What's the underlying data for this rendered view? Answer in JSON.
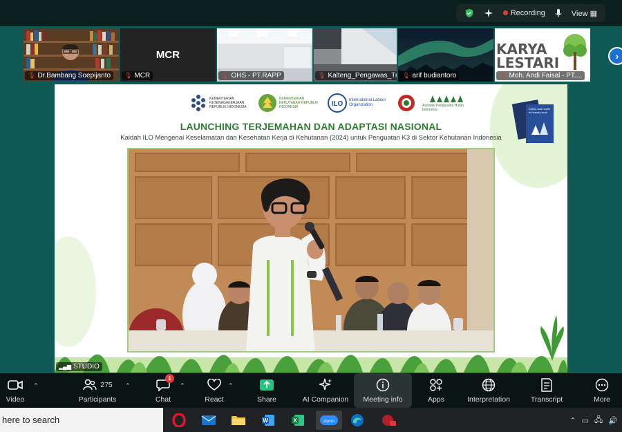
{
  "topbar": {
    "recording_label": "Recording",
    "view_label": "View"
  },
  "gallery": {
    "tiles": [
      {
        "label": "Dr.Bambang Soepijanto",
        "muted": true
      },
      {
        "label": "MCR",
        "muted": true,
        "center_text": "MCR"
      },
      {
        "label": "OHS - PT.RAPP",
        "muted": true
      },
      {
        "label": "Kalteng_Pengawas_Tri...",
        "muted": true
      },
      {
        "label": "arif budiantoro",
        "muted": true
      },
      {
        "label": "Moh. Andi Faisal - PT....",
        "muted": true,
        "sign_text": "KARYA LESTARI"
      }
    ]
  },
  "slide": {
    "logos": [
      {
        "name": "KEMENTERIAN KETENAGAKERJAAN REPUBLIK INDONESIA"
      },
      {
        "name": "KEMENTERIAN KEHUTANAN REPUBLIK INDONESIA"
      },
      {
        "name": "International Labour Organization"
      },
      {
        "name": ""
      },
      {
        "name": "Asosiasi Pengusaha Hutan Indonesia"
      }
    ],
    "title": "LAUNCHING TERJEMAHAN DAN ADAPTASI NASIONAL",
    "subtitle": "Kaidah ILO Mengenai Keselamatan dan Kesehatan Kerja di Kehutanan (2024) untuk Penguatan K3 di Sektor Kehutanan Indonesia",
    "book_title": "Safety and health in forestry work",
    "studio_label": "STUDIO"
  },
  "toolbar": {
    "video": "Video",
    "participants": "Participants",
    "participants_count": "275",
    "chat": "Chat",
    "chat_badge": "1",
    "react": "React",
    "share": "Share",
    "ai_companion": "AI Companion",
    "meeting_info": "Meeting info",
    "apps": "Apps",
    "interpretation": "Interpretation",
    "transcript": "Transcript",
    "more": "More"
  },
  "taskbar": {
    "search_text": "here to search"
  },
  "colors": {
    "accent": "#1d6fd1",
    "recording": "#e23b3b",
    "share_green": "#26c281",
    "title_green": "#2e7d32"
  }
}
